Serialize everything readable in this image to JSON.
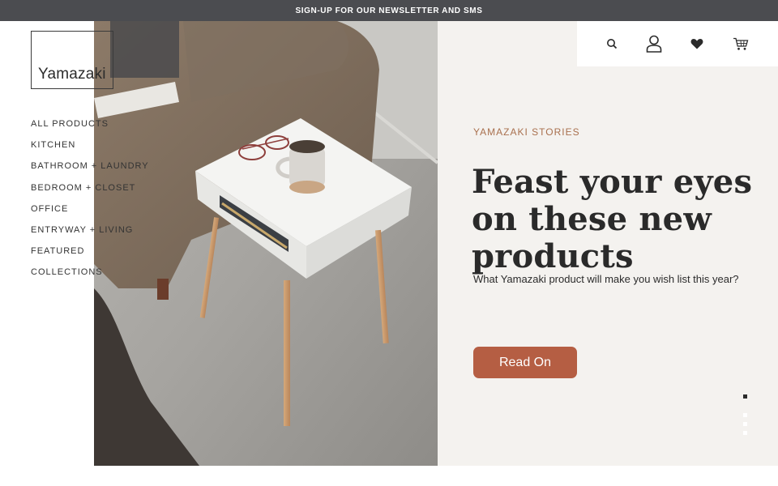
{
  "announcement": {
    "text": "SIGN-UP FOR OUR NEWSLETTER AND SMS"
  },
  "brand": {
    "logo_text": "Yamazaki"
  },
  "nav": {
    "items": [
      {
        "label": "ALL PRODUCTS"
      },
      {
        "label": "KITCHEN"
      },
      {
        "label": "BATHROOM + LAUNDRY"
      },
      {
        "label": "BEDROOM + CLOSET"
      },
      {
        "label": "OFFICE"
      },
      {
        "label": "ENTRYWAY + LIVING"
      },
      {
        "label": "FEATURED"
      },
      {
        "label": "COLLECTIONS"
      }
    ]
  },
  "header_icons": [
    "search-icon",
    "account-icon",
    "wishlist-heart-icon",
    "cart-icon"
  ],
  "hero": {
    "kicker": "YAMAZAKI STORIES",
    "headline": "Feast your eyes on these new products",
    "subtext": "What Yamazaki product will make you wish list this year?",
    "cta_label": "Read On",
    "image_subject": "white side table with wooden legs beside a sofa, holding a coffee mug and glasses"
  },
  "slider": {
    "total": 4,
    "active": 1
  },
  "colors": {
    "announcement_bg": "#4b4c50",
    "panel_bg": "#f4f2ef",
    "accent": "#b55e43",
    "kicker": "#a9704e",
    "text": "#2b2b2b"
  }
}
